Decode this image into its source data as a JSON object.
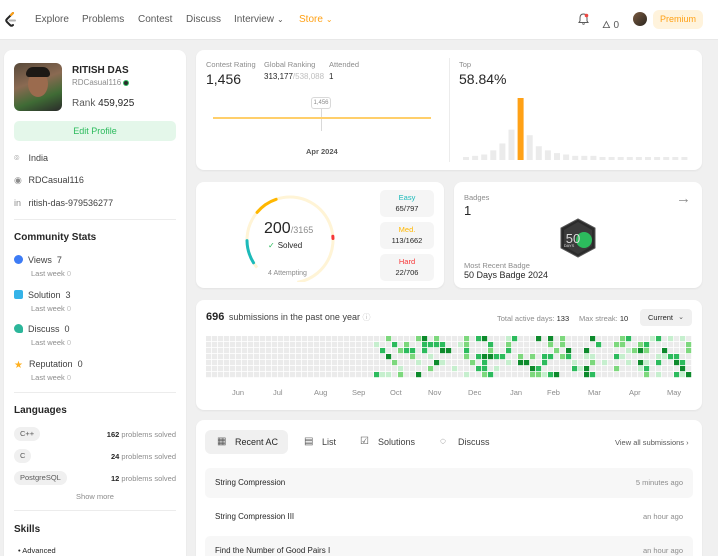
{
  "nav": {
    "links": [
      "Explore",
      "Problems",
      "Contest",
      "Discuss"
    ],
    "interview": "Interview",
    "store": "Store",
    "fire_count": "0",
    "premium": "Premium"
  },
  "profile": {
    "name": "RITISH DAS",
    "handle": "RDCasual116",
    "rank_label": "Rank",
    "rank_value": "459,925",
    "edit_label": "Edit Profile",
    "location": "India",
    "github": "RDCasual116",
    "linkedin": "ritish-das-979536277"
  },
  "community": {
    "title": "Community Stats",
    "last_week_label": "Last week",
    "items": [
      {
        "label": "Views",
        "value": "7",
        "last_week": "0",
        "color": "#3d7cf5"
      },
      {
        "label": "Solution",
        "value": "3",
        "last_week": "0",
        "color": "#35b3e8"
      },
      {
        "label": "Discuss",
        "value": "0",
        "last_week": "0",
        "color": "#2cb69a"
      },
      {
        "label": "Reputation",
        "value": "0",
        "last_week": "0",
        "color": "#ffb020"
      }
    ]
  },
  "languages": {
    "title": "Languages",
    "solved_label": "problems solved",
    "items": [
      {
        "name": "C++",
        "count": "162"
      },
      {
        "name": "C",
        "count": "24"
      },
      {
        "name": "PostgreSQL",
        "count": "12"
      }
    ],
    "show_more": "Show more"
  },
  "skills": {
    "title": "Skills",
    "first": "Advanced"
  },
  "contest": {
    "rating_label": "Contest Rating",
    "rating": "1,456",
    "ranking_label": "Global Ranking",
    "ranking": "313,177",
    "ranking_total": "/538,088",
    "attended_label": "Attended",
    "attended": "1",
    "tag": "1,456",
    "date": "Apr 2024",
    "top_label": "Top",
    "top": "58.84%",
    "histogram": [
      2,
      3,
      4,
      7,
      12,
      22,
      45,
      18,
      10,
      7,
      5,
      4,
      3,
      3,
      3,
      2,
      2,
      2,
      2,
      2,
      2,
      2,
      2,
      2,
      2
    ],
    "highlight_index": 6
  },
  "solved": {
    "count": "200",
    "total": "/3165",
    "label": "Solved",
    "attempting": "4 Attempting",
    "easy_label": "Easy",
    "easy": "65/797",
    "med_label": "Med.",
    "med": "113/1662",
    "hard_label": "Hard",
    "hard": "22/706",
    "easy_frac": 0.325,
    "med_frac": 0.565,
    "hard_frac": 0.11
  },
  "badges": {
    "label": "Badges",
    "count": "1",
    "badge_text": "50",
    "badge_sub": "DAYS",
    "recent_label": "Most Recent Badge",
    "recent": "50 Days Badge 2024"
  },
  "submissions": {
    "count": "696",
    "title": "submissions in the past one year",
    "active_label": "Total active days:",
    "active": "133",
    "streak_label": "Max streak:",
    "streak": "10",
    "select": "Current",
    "months": [
      "Jun",
      "Jul",
      "Aug",
      "Sep",
      "Oct",
      "Nov",
      "Dec",
      "Jan",
      "Feb",
      "Mar",
      "Apr",
      "May"
    ]
  },
  "recent": {
    "tabs": [
      "Recent AC",
      "List",
      "Solutions",
      "Discuss"
    ],
    "view_all": "View all submissions",
    "rows": [
      {
        "title": "String Compression",
        "time": "5 minutes ago"
      },
      {
        "title": "String Compression III",
        "time": "an hour ago"
      },
      {
        "title": "Find the Number of Good Pairs I",
        "time": "an hour ago"
      }
    ]
  }
}
